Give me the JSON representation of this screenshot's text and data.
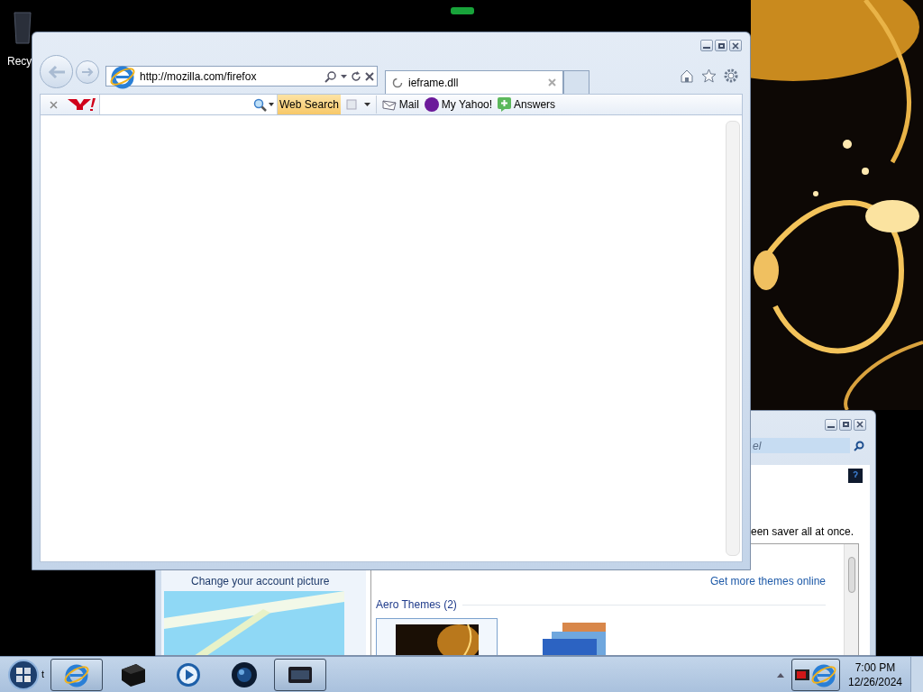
{
  "desktop": {
    "icons": [
      {
        "label": "Recy"
      }
    ]
  },
  "browser": {
    "address": "http://mozilla.com/firefox",
    "tabs": [
      {
        "label": "ieframe.dll",
        "selected": true
      }
    ],
    "toolbar": {
      "search_button": "Web Search",
      "links": [
        {
          "label": "Mail",
          "kind": "mail"
        },
        {
          "label": "My Yahoo!",
          "kind": "myyahoo"
        },
        {
          "label": "Answers",
          "kind": "answers"
        }
      ]
    }
  },
  "control_panel": {
    "search_text": "el",
    "description": "een saver all at once.",
    "left_link": "Change your account picture",
    "more_link": "Get more themes online",
    "group": "Aero Themes (2)",
    "themes": [
      {
        "selected": true
      },
      {
        "selected": false
      }
    ]
  },
  "taskbar": {
    "start_label": "t",
    "apps": [
      {
        "kind": "ie",
        "running": true
      },
      {
        "kind": "box",
        "running": false
      },
      {
        "kind": "media",
        "running": false
      },
      {
        "kind": "globe",
        "running": false
      },
      {
        "kind": "window",
        "running": true
      }
    ],
    "clock": {
      "time": "7:00 PM",
      "date": "12/26/2024"
    }
  }
}
